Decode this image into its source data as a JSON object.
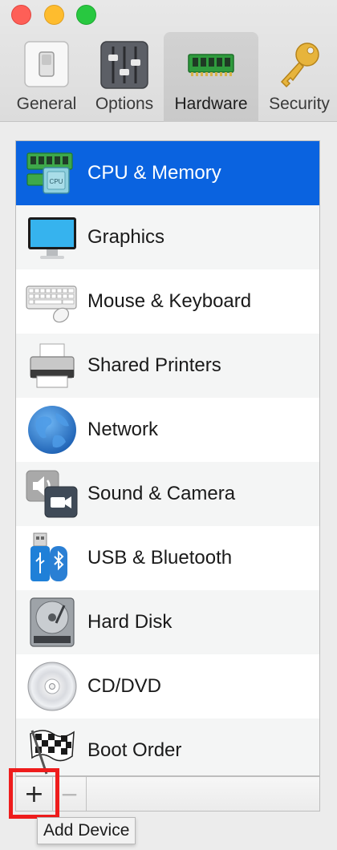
{
  "window": {
    "controls": [
      "close",
      "minimize",
      "zoom"
    ]
  },
  "toolbar": {
    "tabs": [
      {
        "label": "General",
        "icon": "switch-icon"
      },
      {
        "label": "Options",
        "icon": "sliders-icon"
      },
      {
        "label": "Hardware",
        "icon": "ram-chip-icon",
        "selected": true
      },
      {
        "label": "Security",
        "icon": "key-icon"
      }
    ]
  },
  "devices": {
    "items": [
      {
        "label": "CPU & Memory",
        "icon": "cpu-memory-icon",
        "icon_text": "CPU",
        "selected": true
      },
      {
        "label": "Graphics",
        "icon": "monitor-icon"
      },
      {
        "label": "Mouse & Keyboard",
        "icon": "keyboard-mouse-icon"
      },
      {
        "label": "Shared Printers",
        "icon": "printer-icon"
      },
      {
        "label": "Network",
        "icon": "globe-icon"
      },
      {
        "label": "Sound & Camera",
        "icon": "speaker-camera-icon"
      },
      {
        "label": "USB & Bluetooth",
        "icon": "usb-bluetooth-icon"
      },
      {
        "label": "Hard Disk",
        "icon": "hard-disk-icon"
      },
      {
        "label": "CD/DVD",
        "icon": "disc-icon"
      },
      {
        "label": "Boot Order",
        "icon": "checkered-flag-icon"
      }
    ]
  },
  "bottom_bar": {
    "add_label": "+",
    "remove_label": "−",
    "remove_enabled": false
  },
  "tooltip": {
    "text": "Add Device"
  },
  "colors": {
    "selection": "#0a63e0",
    "highlight_box": "#ee1c1c"
  }
}
